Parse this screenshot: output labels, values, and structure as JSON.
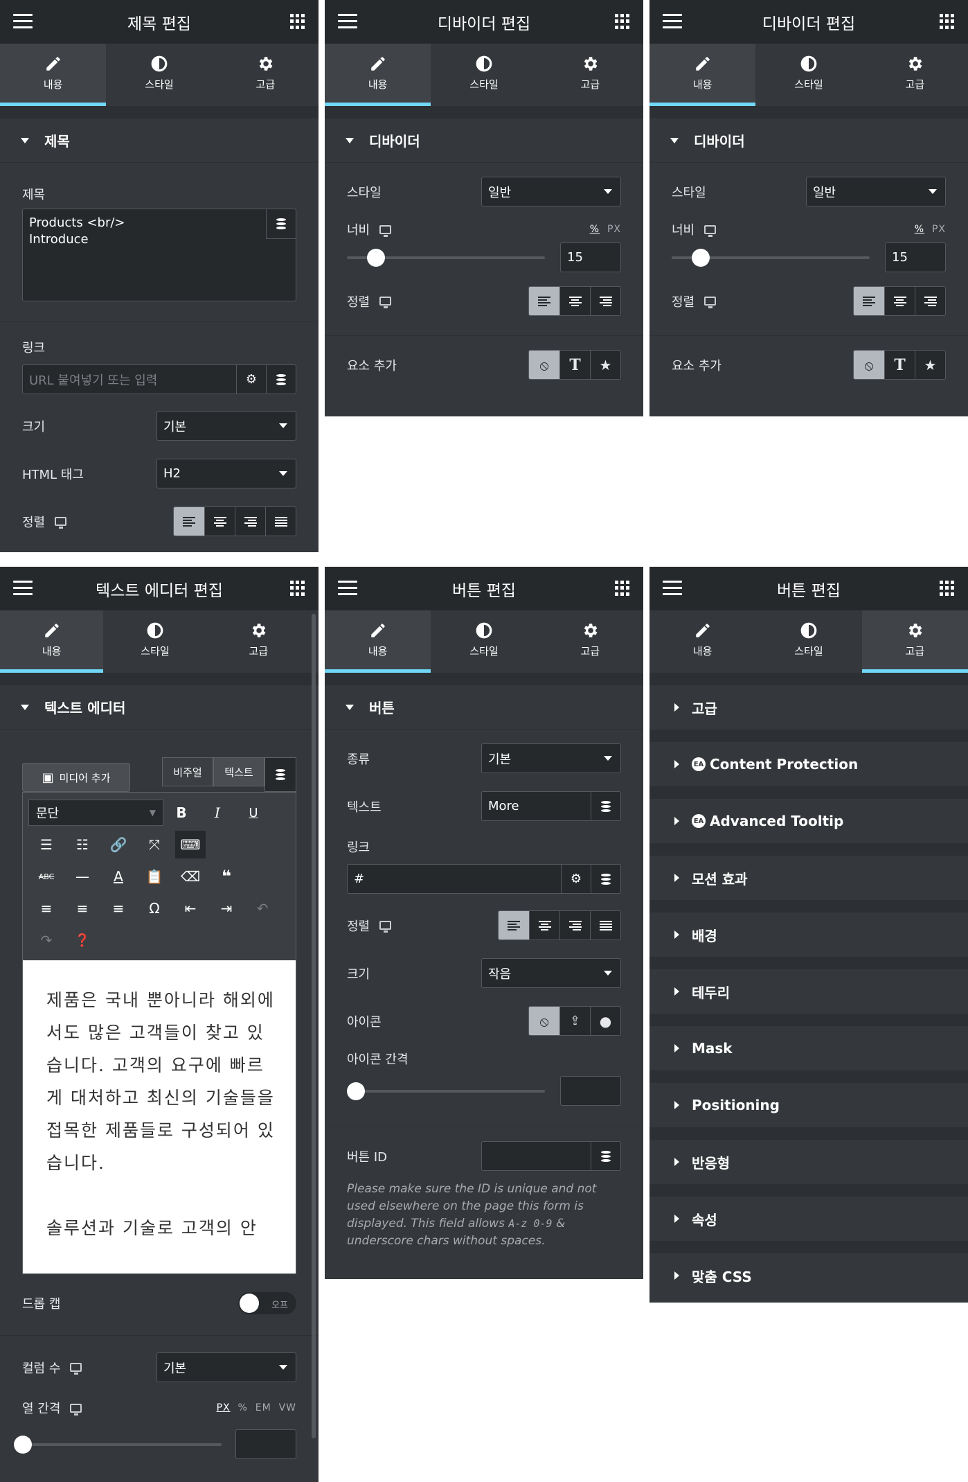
{
  "tabs": {
    "content": "내용",
    "style": "스타일",
    "advanced": "고급"
  },
  "p1": {
    "title": "제목 편집",
    "section": "제목",
    "title_label": "제목",
    "title_value_line1": "Products <br/>",
    "title_value_line2": "Introduce",
    "link_label": "링크",
    "link_placeholder": "URL 붙여넣기 또는 입력",
    "size_label": "크기",
    "size_value": "기본",
    "tag_label": "HTML 태그",
    "tag_value": "H2",
    "align_label": "정렬"
  },
  "p2": {
    "title": "디바이더 편집",
    "section": "디바이더",
    "style_label": "스타일",
    "style_value": "일반",
    "width_label": "너비",
    "unit_pct": "%",
    "unit_px": "PX",
    "width_value": "15",
    "width_fraction": 0.15,
    "align_label": "정렬",
    "add_label": "요소 추가"
  },
  "p3": {
    "title": "디바이더 편집",
    "section": "디바이더",
    "style_label": "스타일",
    "style_value": "일반",
    "width_label": "너비",
    "unit_pct": "%",
    "unit_px": "PX",
    "width_value": "15",
    "align_label": "정렬",
    "add_label": "요소 추가"
  },
  "p4": {
    "title": "텍스트 에디터 편집",
    "section": "텍스트 에디터",
    "media_button": "미디어 추가",
    "tab_visual": "비주얼",
    "tab_text": "텍스트",
    "format_value": "문단",
    "body_text": "제품은 국내 뿐아니라 해외에서도 많은 고객들이 찾고 있습니다. 고객의 요구에 빠르게 대처하고 최신의 기술들을 접목한 제품들로 구성되어 있습니다.",
    "body_text2": "솔루션과 기술로 고객의 안",
    "dropcap_label": "드롭 캡",
    "dropcap_state": "오프",
    "columns_label": "컬럼 수",
    "columns_value": "기본",
    "gap_label": "열 간격",
    "unit_px": "PX",
    "unit_pct": "%",
    "unit_em": "EM",
    "unit_vw": "VW"
  },
  "p5": {
    "title": "버튼 편집",
    "section": "버튼",
    "type_label": "종류",
    "type_value": "기본",
    "text_label": "텍스트",
    "text_value": "More",
    "link_label": "링크",
    "link_value": "#",
    "align_label": "정렬",
    "size_label": "크기",
    "size_value": "작음",
    "icon_label": "아이콘",
    "icon_gap_label": "아이콘 간격",
    "id_label": "버튼 ID",
    "note_a": "Please make sure the ID is unique and not used elsewhere on the page this form is displayed. This field allows ",
    "note_code": "A-z 0-9",
    "note_b": " & underscore chars without spaces."
  },
  "p6": {
    "title": "버튼 편집",
    "sections": [
      "고급",
      "Content Protection",
      "Advanced Tooltip",
      "모션 효과",
      "배경",
      "테두리",
      "Mask",
      "Positioning",
      "반응형",
      "속성",
      "맞춤 CSS"
    ]
  },
  "colors": {
    "panel": "#34383c",
    "header": "#26292c",
    "accent": "#71d7f7"
  }
}
